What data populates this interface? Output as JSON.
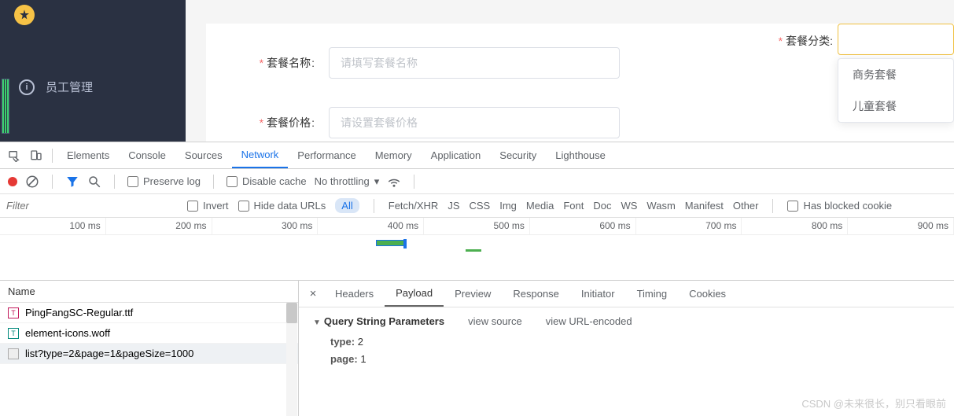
{
  "sidebar": {
    "items": [
      {
        "label": "员工管理"
      }
    ]
  },
  "form": {
    "name_label": "套餐名称",
    "name_placeholder": "请填写套餐名称",
    "price_label": "套餐价格",
    "price_placeholder": "请设置套餐价格",
    "category_label": "套餐分类",
    "dropdown": [
      "商务套餐",
      "儿童套餐"
    ]
  },
  "devtools": {
    "tabs": [
      "Elements",
      "Console",
      "Sources",
      "Network",
      "Performance",
      "Memory",
      "Application",
      "Security",
      "Lighthouse"
    ],
    "active_tab": "Network",
    "preserve_log": "Preserve log",
    "disable_cache": "Disable cache",
    "throttling": "No throttling",
    "filter_placeholder": "Filter",
    "invert": "Invert",
    "hide_data_urls": "Hide data URLs",
    "filter_types": [
      "All",
      "Fetch/XHR",
      "JS",
      "CSS",
      "Img",
      "Media",
      "Font",
      "Doc",
      "WS",
      "Wasm",
      "Manifest",
      "Other"
    ],
    "has_blocked": "Has blocked cookie",
    "timeline_ticks": [
      "100 ms",
      "200 ms",
      "300 ms",
      "400 ms",
      "500 ms",
      "600 ms",
      "700 ms",
      "800 ms",
      "900 ms"
    ],
    "name_col": "Name",
    "requests": [
      {
        "icon": "font",
        "name": "PingFangSC-Regular.ttf"
      },
      {
        "icon": "woff",
        "name": "element-icons.woff"
      },
      {
        "icon": "xhr",
        "name": "list?type=2&page=1&pageSize=1000"
      }
    ],
    "selected_req_idx": 2,
    "detail_tabs": [
      "Headers",
      "Payload",
      "Preview",
      "Response",
      "Initiator",
      "Timing",
      "Cookies"
    ],
    "active_detail_tab": "Payload",
    "qsp_title": "Query String Parameters",
    "view_source": "view source",
    "view_url_encoded": "view URL-encoded",
    "params": [
      {
        "k": "type",
        "v": "2"
      },
      {
        "k": "page",
        "v": "1"
      }
    ]
  },
  "watermark": "CSDN @未来很长，别只看眼前"
}
